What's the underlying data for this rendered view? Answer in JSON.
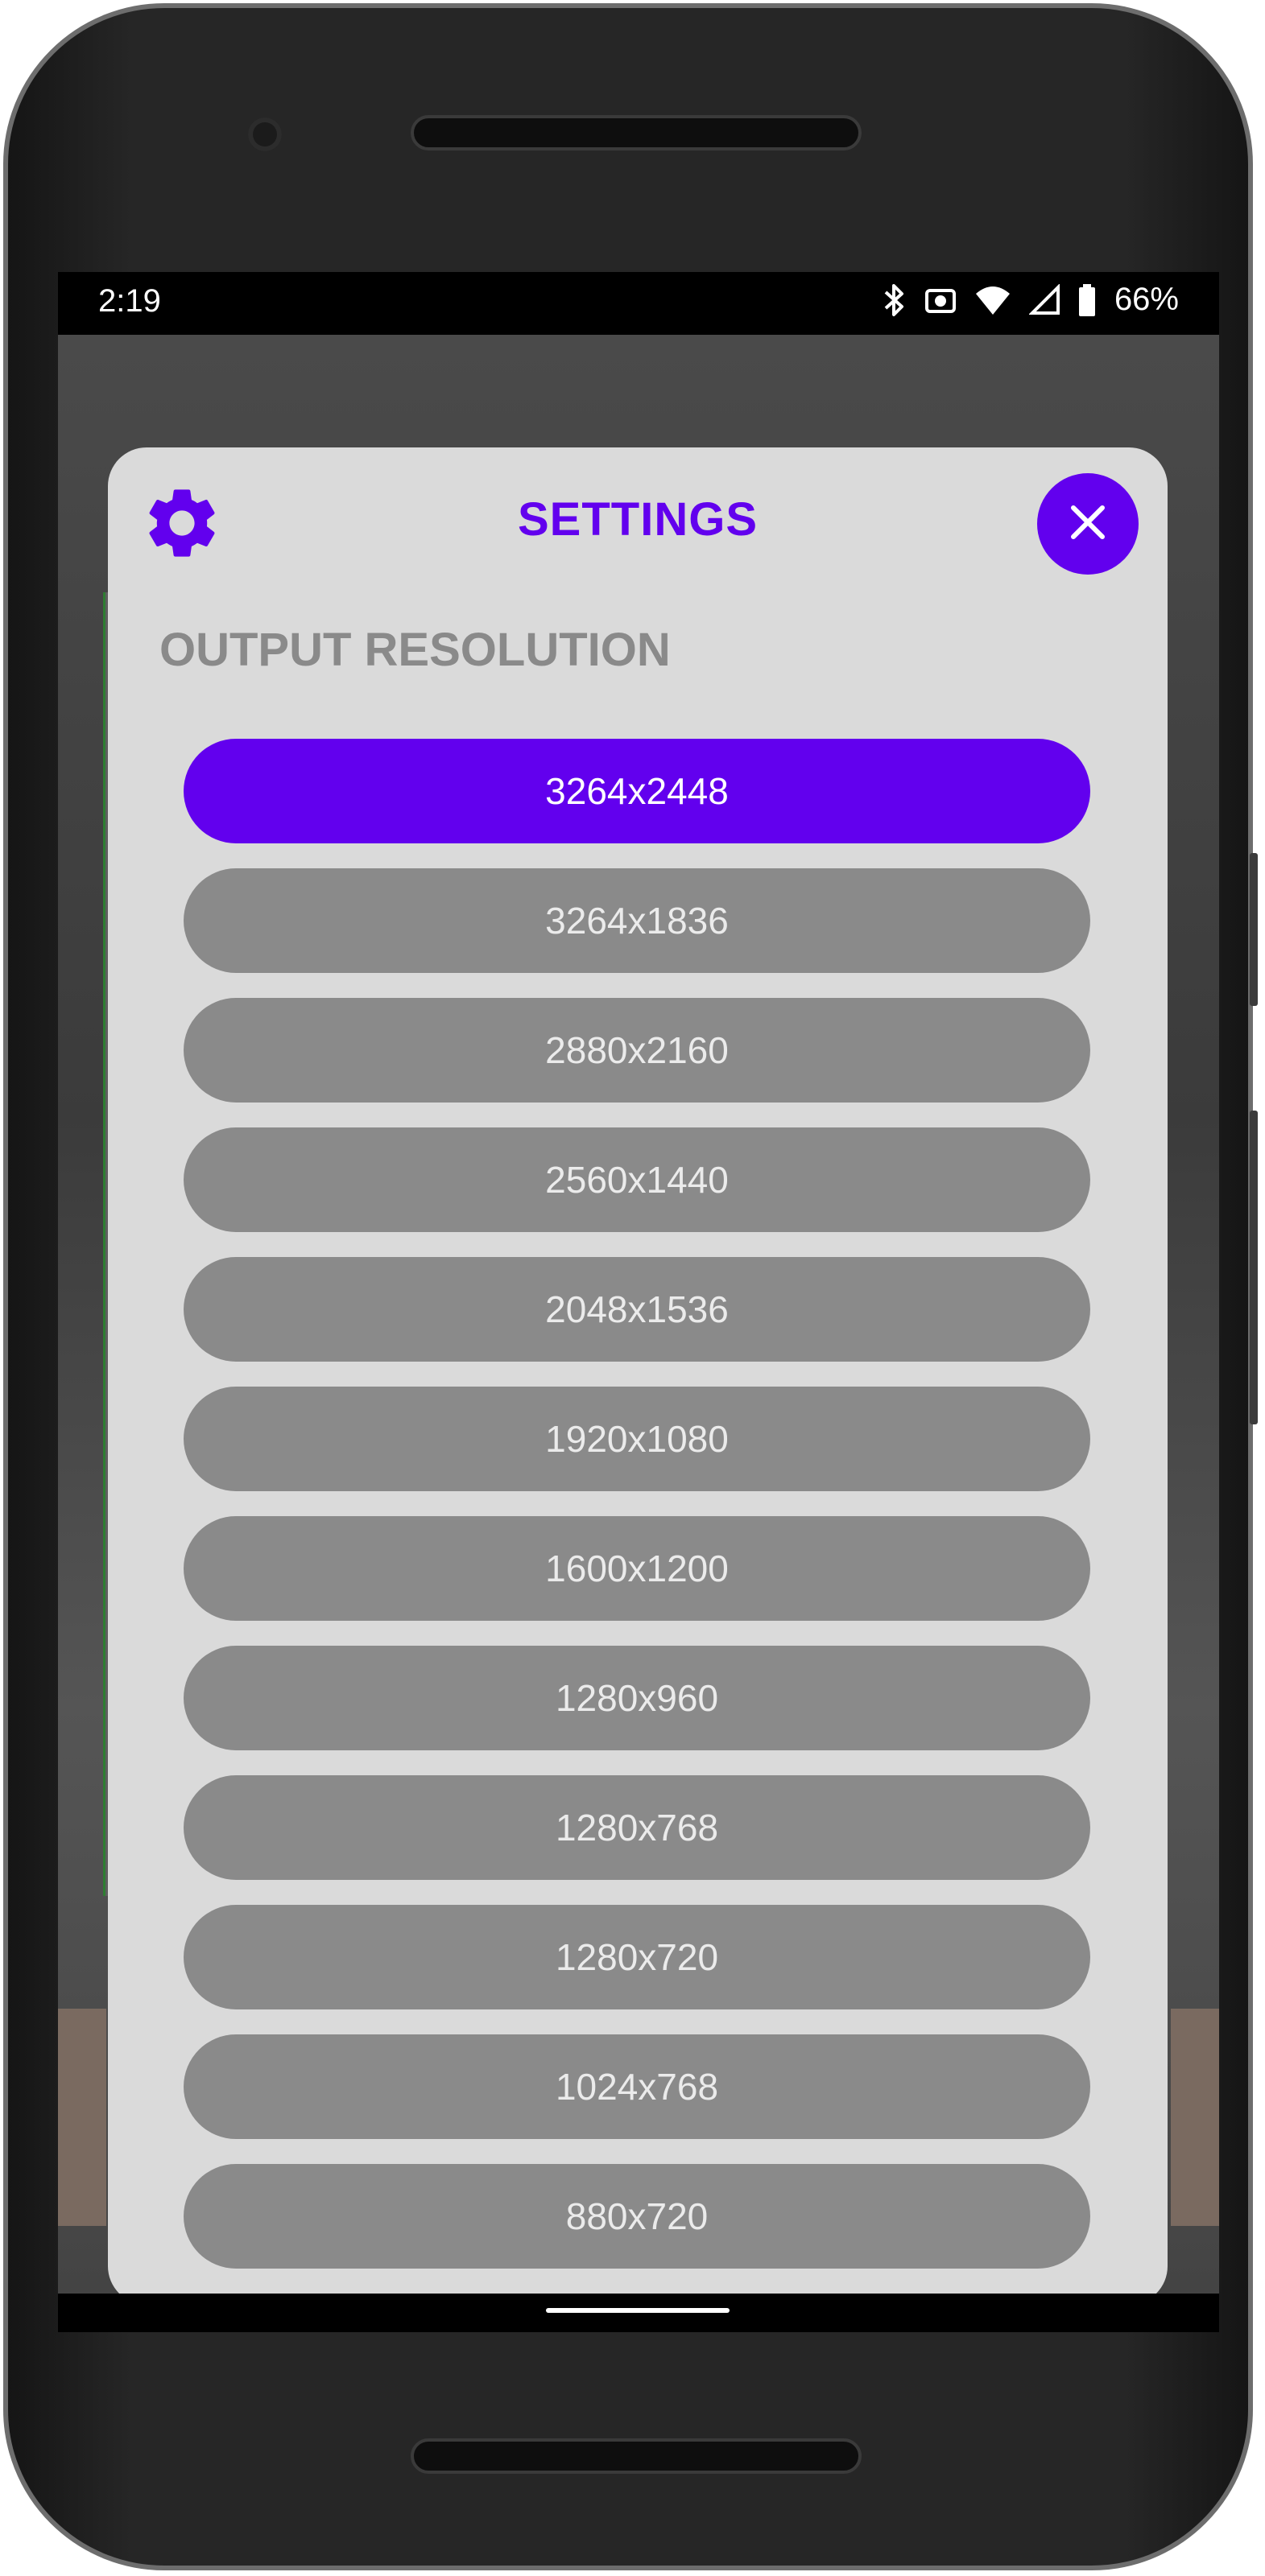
{
  "status_bar": {
    "time": "2:19",
    "battery": "66%",
    "icons": [
      "bluetooth-icon",
      "screenshot-icon",
      "wifi-icon",
      "signal-icon",
      "battery-icon"
    ]
  },
  "dialog": {
    "title": "SETTINGS",
    "section_label": "OUTPUT RESOLUTION",
    "icons": {
      "header": "gear-icon",
      "close": "close-icon"
    },
    "colors": {
      "accent": "#6200ee",
      "unselected": "#8a8a8a",
      "dialog_bg": "#dadada"
    },
    "resolutions": [
      {
        "label": "3264x2448",
        "selected": true
      },
      {
        "label": "3264x1836",
        "selected": false
      },
      {
        "label": "2880x2160",
        "selected": false
      },
      {
        "label": "2560x1440",
        "selected": false
      },
      {
        "label": "2048x1536",
        "selected": false
      },
      {
        "label": "1920x1080",
        "selected": false
      },
      {
        "label": "1600x1200",
        "selected": false
      },
      {
        "label": "1280x960",
        "selected": false
      },
      {
        "label": "1280x768",
        "selected": false
      },
      {
        "label": "1280x720",
        "selected": false
      },
      {
        "label": "1024x768",
        "selected": false
      },
      {
        "label": "880x720",
        "selected": false
      }
    ]
  }
}
